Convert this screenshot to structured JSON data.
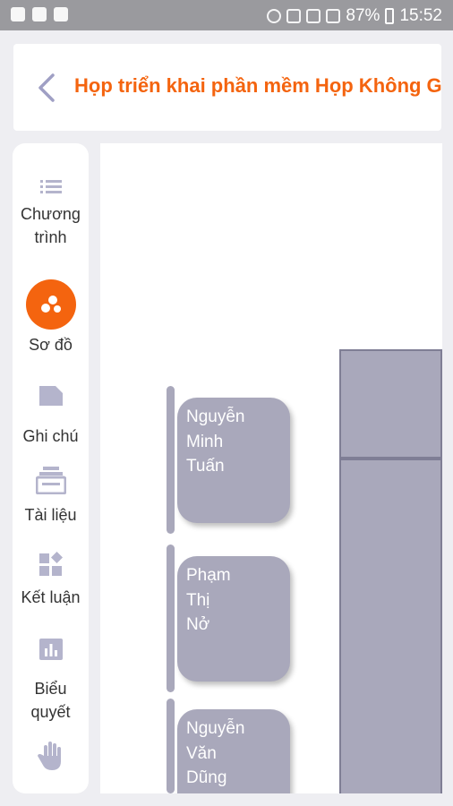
{
  "status_bar": {
    "battery": "87%",
    "time": "15:52"
  },
  "header": {
    "title": "Họp triển khai phần mềm Họp Không Giấy"
  },
  "sidebar": {
    "items": [
      {
        "label": "Chương trình",
        "icon": "list-icon",
        "active": false
      },
      {
        "label": "Sơ đồ",
        "icon": "diagram-icon",
        "active": true
      },
      {
        "label": "Ghi chú",
        "icon": "note-icon",
        "active": false
      },
      {
        "label": "Tài liệu",
        "icon": "document-stack-icon",
        "active": false
      },
      {
        "label": "Kết luận",
        "icon": "widgets-icon",
        "active": false
      },
      {
        "label": "Biểu quyết",
        "icon": "bar-chart-icon",
        "active": false
      },
      {
        "label": "",
        "icon": "hand-icon",
        "active": false
      }
    ]
  },
  "seating": {
    "people": [
      {
        "line1": "Nguyễn",
        "line2": "Minh",
        "line3": "Tuấn"
      },
      {
        "line1": "Phạm",
        "line2": "Thị",
        "line3": "Nở"
      },
      {
        "line1": "Nguyễn",
        "line2": "Văn",
        "line3": "Dũng"
      }
    ]
  },
  "colors": {
    "accent": "#f4640f",
    "icon": "#b4b4cc",
    "card": "#a9a8bb"
  }
}
